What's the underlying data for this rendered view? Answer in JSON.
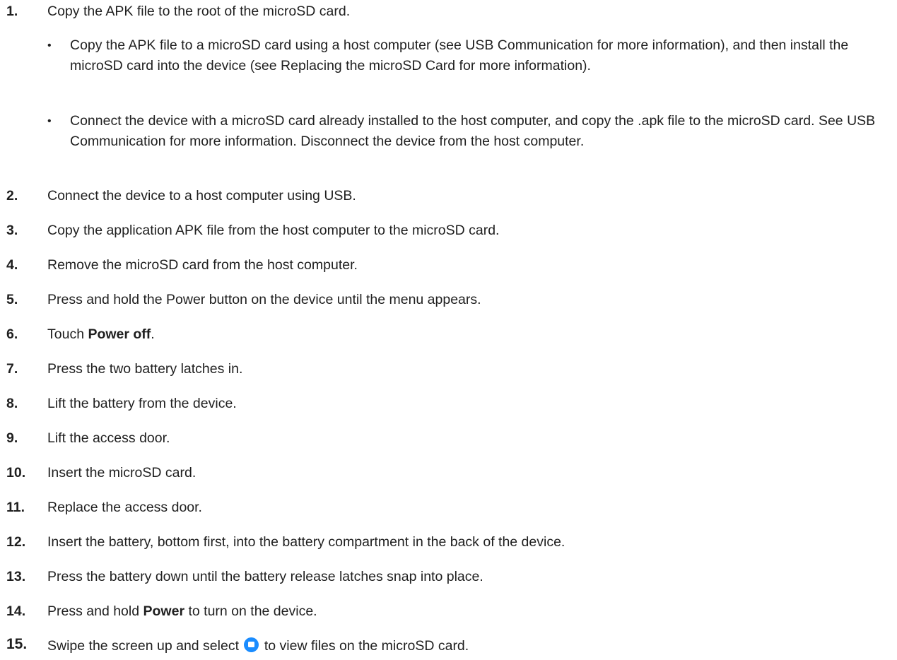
{
  "steps": [
    {
      "num": "1.",
      "text": "Copy the APK file to the root of the microSD card."
    },
    {
      "num": "2.",
      "text": "Connect the device to a host computer using USB."
    },
    {
      "num": "3.",
      "text": "Copy the application APK file from the host computer to the microSD card."
    },
    {
      "num": "4.",
      "text": "Remove the microSD card from the host computer."
    },
    {
      "num": "5.",
      "text": "Press and hold the Power button on the device until the menu appears."
    },
    {
      "num": "6.",
      "pre": "Touch ",
      "bold": "Power off",
      "post": "."
    },
    {
      "num": "7.",
      "text": "Press the two battery latches in."
    },
    {
      "num": "8.",
      "text": "Lift the battery from the device."
    },
    {
      "num": "9.",
      "text": "Lift the access door."
    },
    {
      "num": "10.",
      "text": "Insert the microSD card."
    },
    {
      "num": "11.",
      "text": "Replace the access door."
    },
    {
      "num": "12.",
      "text": "Insert the battery, bottom first, into the battery compartment in the back of the device."
    },
    {
      "num": "13.",
      "text": "Press the battery down until the battery release latches snap into place."
    },
    {
      "num": "14.",
      "pre": "Press and hold ",
      "bold": "Power",
      "post": " to turn on the device."
    },
    {
      "num": "15.",
      "pre": "Swipe the screen up and select ",
      "icon": "files-app-icon",
      "post": " to view files on the microSD card."
    }
  ],
  "substeps": [
    {
      "bullet": "•",
      "text": "Copy the APK file to a microSD card using a host computer (see USB Communication for more information), and then install the microSD card into the device (see Replacing the microSD Card for more information)."
    },
    {
      "bullet": "•",
      "text": "Connect the device with a microSD card already installed to the host computer, and copy the .apk file to the microSD card. See USB Communication for more information. Disconnect the device from the host computer."
    }
  ],
  "colors": {
    "text": "#1f1f1f",
    "icon": "#1a8cff",
    "background": "#ffffff"
  }
}
